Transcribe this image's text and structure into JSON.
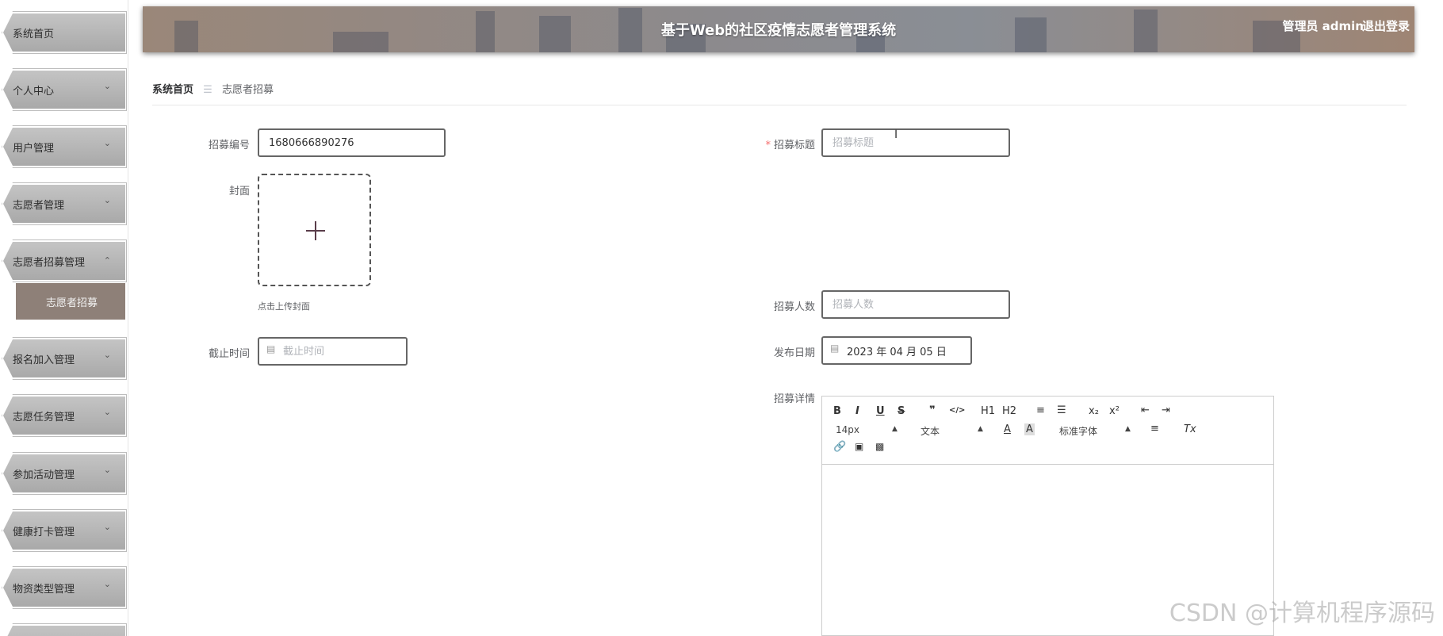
{
  "sidebar": {
    "items": [
      {
        "label": "系统首页",
        "expanded": false
      },
      {
        "label": "个人中心",
        "arrow": "chevron-down-icon"
      },
      {
        "label": "用户管理",
        "arrow": "chevron-down-icon"
      },
      {
        "label": "志愿者管理",
        "arrow": "chevron-down-icon"
      },
      {
        "label": "志愿者招募管理",
        "arrow": "chevron-up-icon"
      },
      {
        "label": "报名加入管理",
        "arrow": "chevron-down-icon"
      },
      {
        "label": "志愿任务管理",
        "arrow": "chevron-down-icon"
      },
      {
        "label": "参加活动管理",
        "arrow": "chevron-down-icon"
      },
      {
        "label": "健康打卡管理",
        "arrow": "chevron-down-icon"
      },
      {
        "label": "物资类型管理",
        "arrow": "chevron-down-icon"
      }
    ],
    "sub_item": {
      "label": "志愿者招募"
    }
  },
  "header": {
    "title": "基于Web的社区疫情志愿者管理系统",
    "user": "管理员 admin",
    "logout": "退出登录"
  },
  "breadcrumb": {
    "home": "系统首页",
    "separator": "☰",
    "current": "志愿者招募"
  },
  "form": {
    "recruit_no": {
      "label": "招募编号",
      "value": "1680666890276"
    },
    "recruit_title": {
      "label": "招募标题",
      "placeholder": "招募标题",
      "required_mark": "*"
    },
    "cover": {
      "label": "封面",
      "tip": "点击上传封面"
    },
    "recruit_count": {
      "label": "招募人数",
      "placeholder": "招募人数"
    },
    "deadline": {
      "label": "截止时间",
      "placeholder": "截止时间"
    },
    "publish_date": {
      "label": "发布日期",
      "value": "2023 年 04 月 05 日"
    },
    "detail": {
      "label": "招募详情"
    }
  },
  "editor": {
    "toolbar_row1": [
      "B",
      "I",
      "U",
      "S",
      "❞",
      "</>",
      "H1",
      "H2",
      "≡",
      "☰",
      "x₂",
      "x²",
      "⇤",
      "⇥"
    ],
    "font_size": "14px",
    "text_type": "文本",
    "font_family": "标准字体",
    "row2_icons": [
      "A",
      "A",
      "≡",
      "Tx"
    ],
    "row3_icons": [
      "link-icon",
      "image-icon",
      "video-icon"
    ]
  },
  "watermark": "CSDN @计算机程序源码",
  "colors": {
    "sidebar_item": "#b3b3b3",
    "sidebar_active_sub": "#8e8078",
    "header_bg": "#8f8a88",
    "required": "#f56c6c"
  }
}
